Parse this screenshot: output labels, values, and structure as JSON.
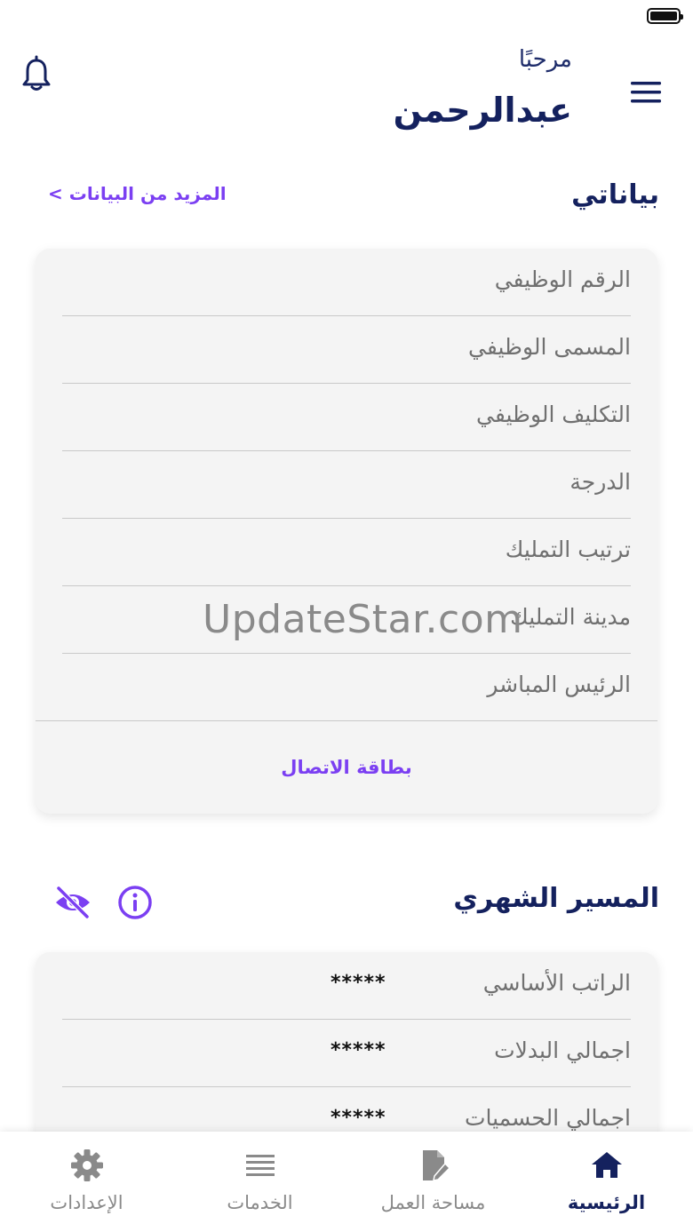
{
  "header": {
    "greeting": "مرحبًا",
    "username": "عبدالرحمن"
  },
  "my_data": {
    "title": "بياناتي",
    "more_link": "المزيد من البيانات >",
    "fields": [
      "الرقم الوظيفي",
      "المسمى الوظيفي",
      "التكليف الوظيفي",
      "الدرجة",
      "ترتيب التمليك",
      "مدينة التمليك",
      "الرئيس المباشر"
    ],
    "contact_card_label": "بطاقة الاتصال"
  },
  "watermark": "UpdateStar.com",
  "payslip": {
    "title": "المسير الشهري",
    "rows": [
      {
        "label": "الراتب الأساسي",
        "value": "*****"
      },
      {
        "label": "اجمالي البدلات",
        "value": "*****"
      },
      {
        "label": "اجمالي الحسميات",
        "value": "*****"
      }
    ]
  },
  "bottom_nav": [
    {
      "label": "الرئيسية",
      "icon": "home-icon",
      "active": true
    },
    {
      "label": "مساحة العمل",
      "icon": "edit-document-icon",
      "active": false
    },
    {
      "label": "الخدمات",
      "icon": "list-icon",
      "active": false
    },
    {
      "label": "الإعدادات",
      "icon": "gear-icon",
      "active": false
    }
  ],
  "colors": {
    "primary": "#14215e",
    "accent": "#7b3ff2",
    "card_bg": "#f4f4f4",
    "muted": "#8a8a8a"
  }
}
